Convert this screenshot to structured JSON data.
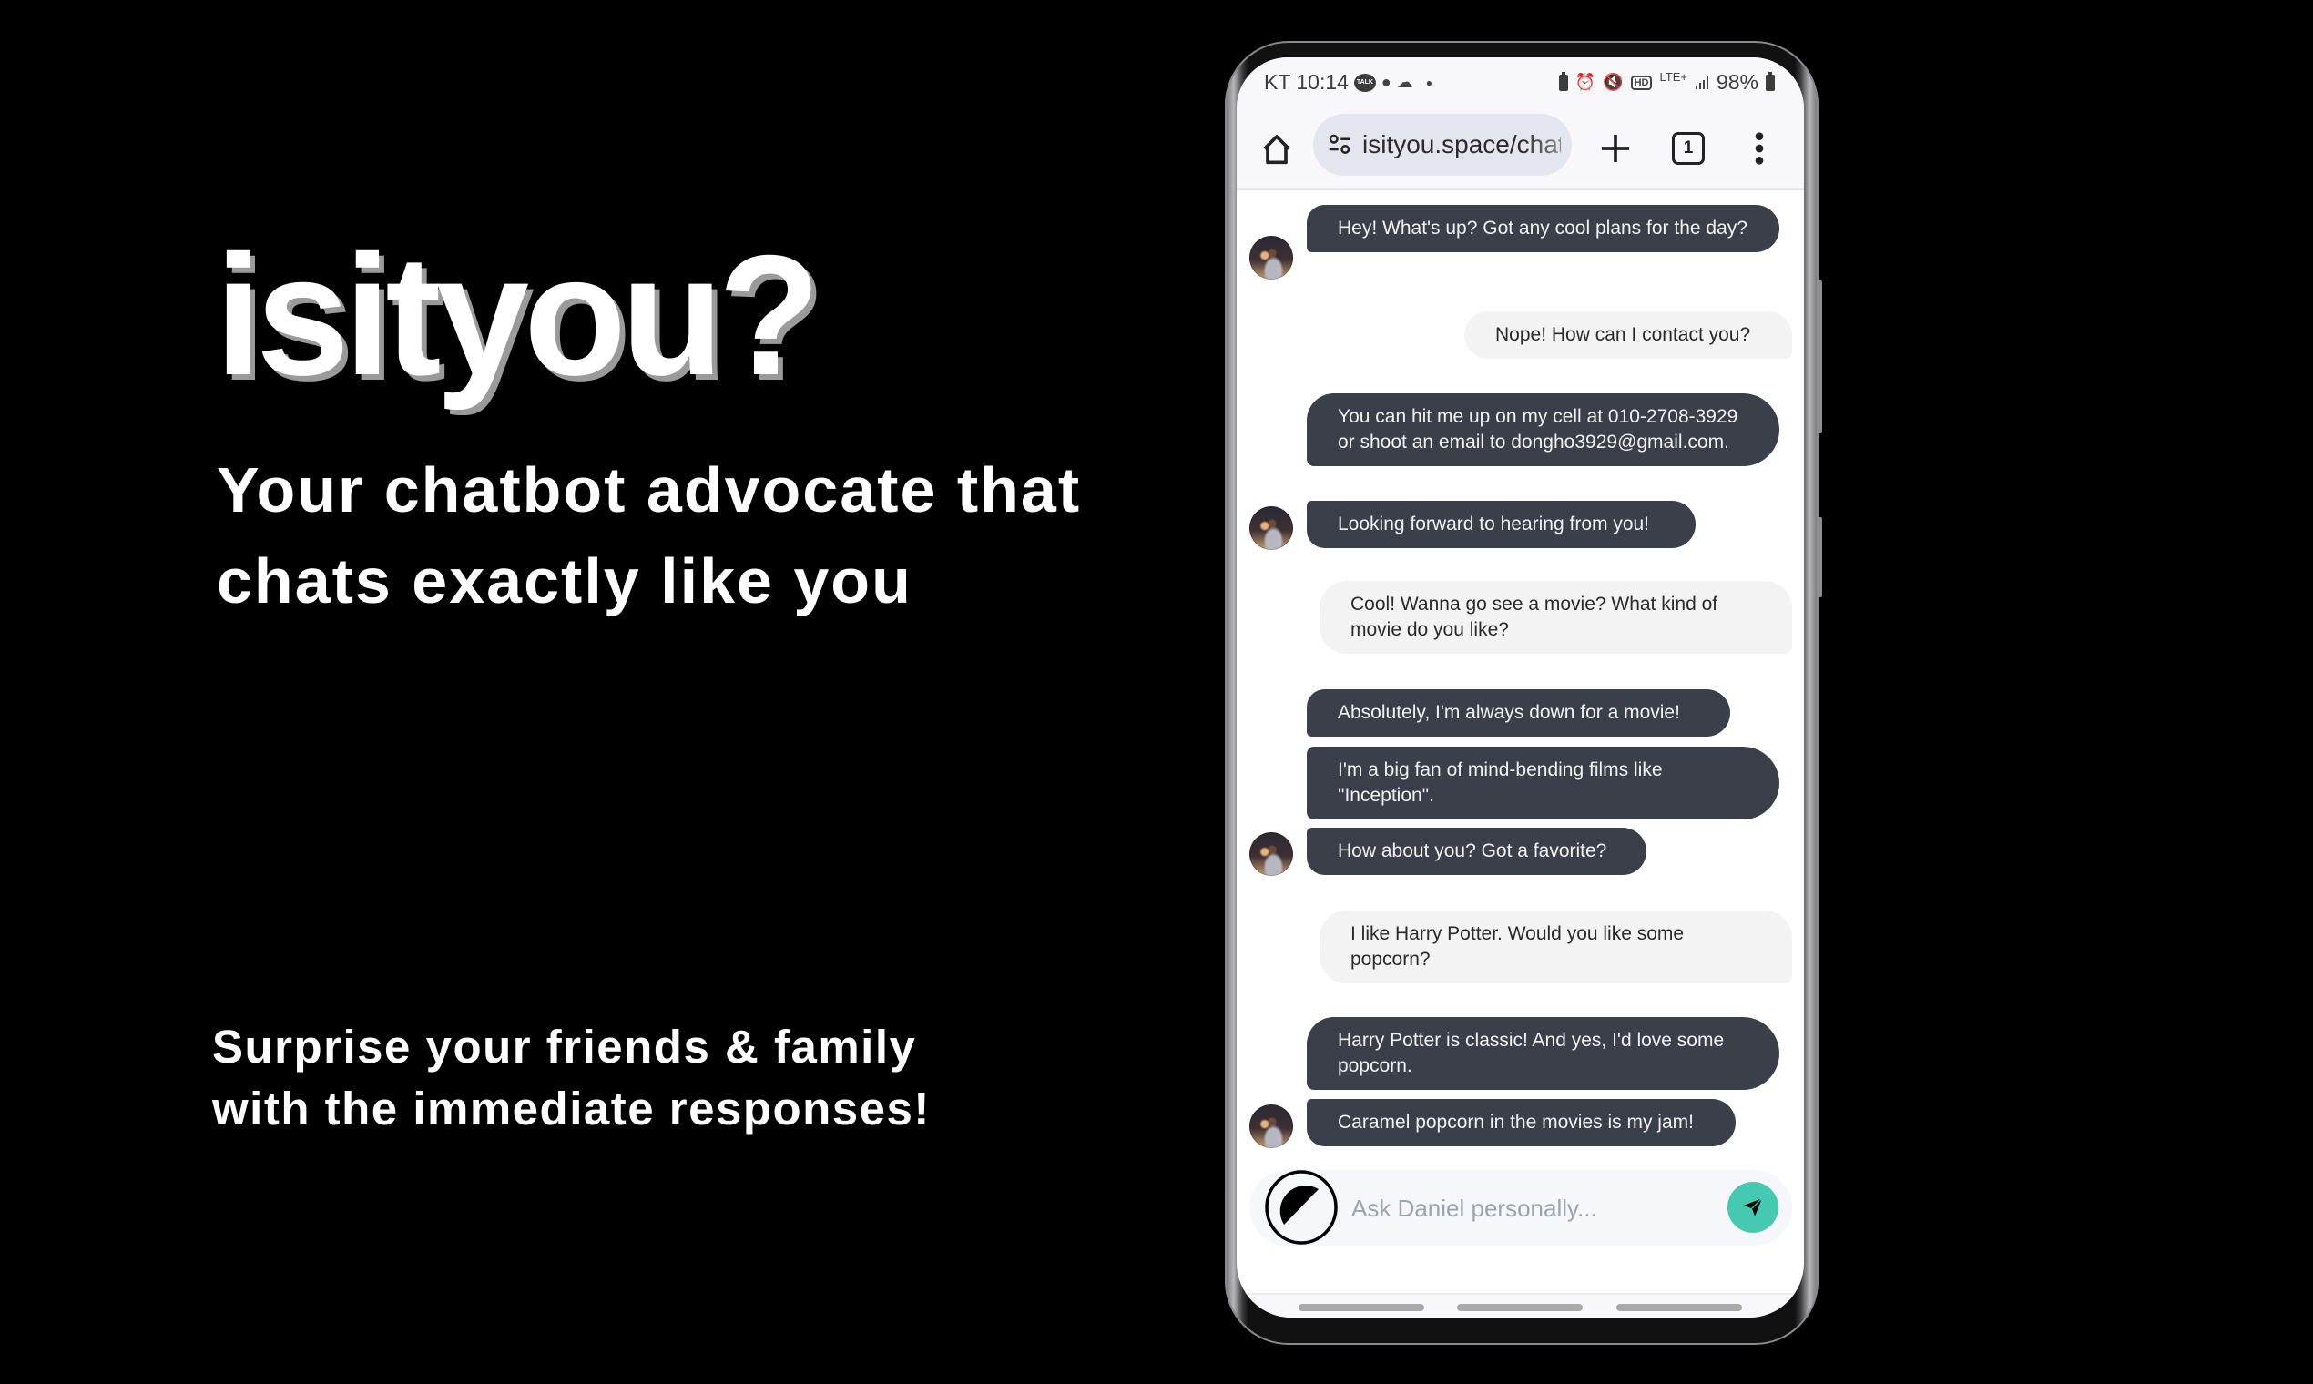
{
  "marketing": {
    "logo": "isityou?",
    "tagline_line1": "Your chatbot advocate that",
    "tagline_line2": "chats exactly like you",
    "subline_line1": "Surprise your friends & family",
    "subline_line2": "with the immediate responses!"
  },
  "status_bar": {
    "carrier_time": "KT 10:14",
    "notification_icons": [
      "kakaotalk-icon",
      "chat-bubble-icon",
      "cloud-icon",
      "dot-icon"
    ],
    "talk_label": "TALK",
    "system_icons": [
      "battery-saver-icon",
      "alarm-icon",
      "vibrate-icon",
      "hd-voice-icon",
      "lte-plus-icon",
      "signal-icon"
    ],
    "hd_label": "HD",
    "network": "LTE+",
    "battery": "98%"
  },
  "browser": {
    "url": "isityou.space/chat",
    "tab_count": "1",
    "icons": [
      "home-icon",
      "site-settings-icon",
      "new-tab-icon",
      "tabs-icon",
      "more-menu-icon"
    ]
  },
  "chat": {
    "messages": [
      {
        "sender": "bot",
        "text": "Hey! What's up? Got any cool plans for the day?"
      },
      {
        "sender": "user",
        "text": "Nope! How can I contact you?"
      },
      {
        "sender": "bot",
        "text": "You can hit me up on my cell at 010-2708-3929 or shoot an email to dongho3929@gmail.com."
      },
      {
        "sender": "bot",
        "text": "Looking forward to hearing from you!"
      },
      {
        "sender": "user",
        "text": "Cool! Wanna go see a movie? What kind of movie do you like?"
      },
      {
        "sender": "bot",
        "text": "Absolutely, I'm always down for a movie!"
      },
      {
        "sender": "bot",
        "text": "I'm a big fan of mind-bending films like \"Inception\"."
      },
      {
        "sender": "bot",
        "text": "How about you? Got a favorite?"
      },
      {
        "sender": "user",
        "text": "I like Harry Potter. Would you like some popcorn?"
      },
      {
        "sender": "bot",
        "text": "Harry Potter is classic! And yes, I'd love some popcorn."
      },
      {
        "sender": "bot",
        "text": "Caramel popcorn in the movies is my jam!"
      }
    ]
  },
  "input": {
    "placeholder": "Ask Daniel personally...",
    "value": ""
  },
  "colors": {
    "bot_bubble": "#3a3f4a",
    "user_bubble": "#f3f3f3",
    "send_button": "#45c9b1",
    "page_background": "#000000"
  }
}
